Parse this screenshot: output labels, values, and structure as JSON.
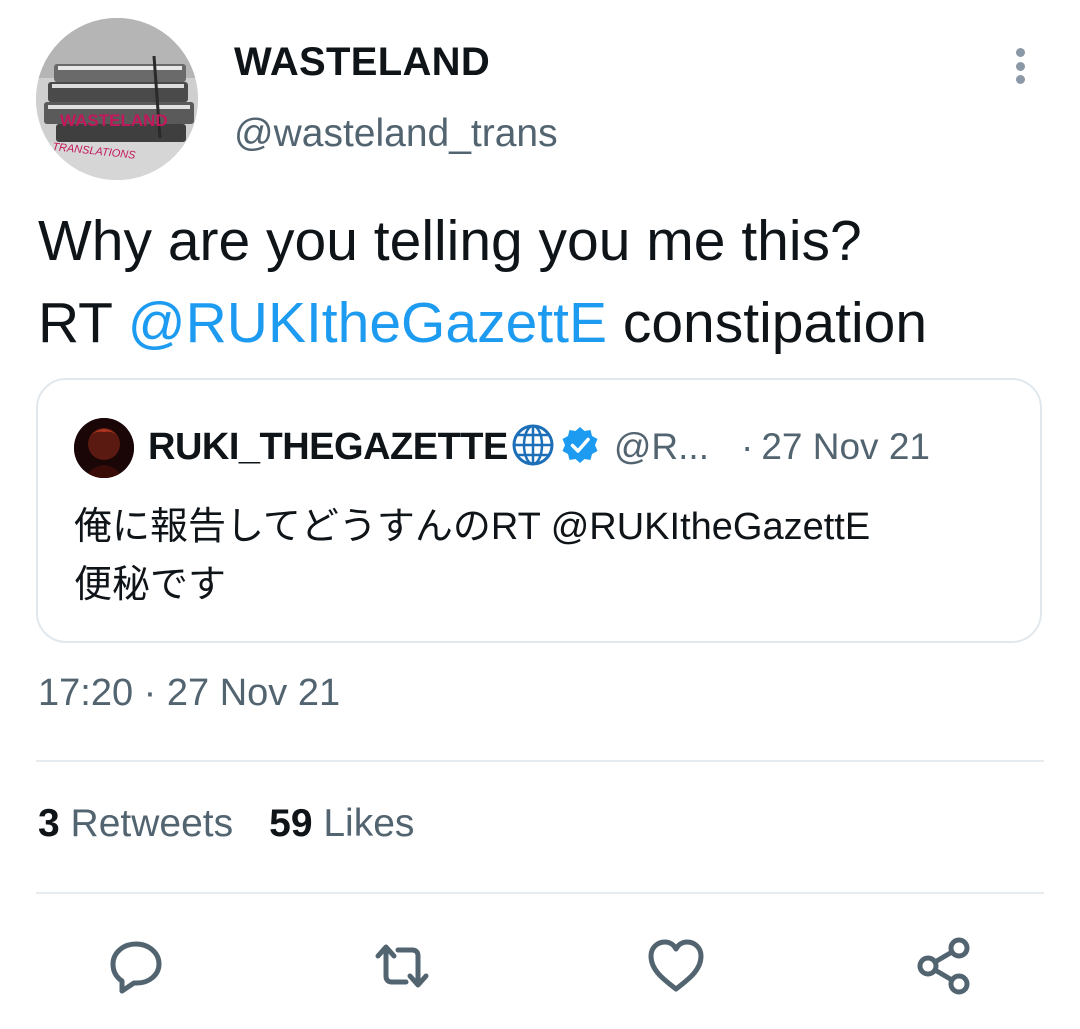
{
  "tweet": {
    "author": {
      "display_name": "WASTELAND",
      "handle": "@wasteland_trans",
      "avatar_text_line1": "WASTELAND",
      "avatar_text_line2": "TRANSLATIONS"
    },
    "text_part1": "Why are you telling you me this?",
    "text_rt": "RT",
    "text_mention": "@RUKItheGazettE",
    "text_part2": "constipation",
    "timestamp": "17:20 · 27 Nov 21"
  },
  "quote": {
    "name": "RUKI_THEGAZETTE",
    "handle": "@R...",
    "separator": "·",
    "date": "27 Nov 21",
    "text_line1": "俺に報告してどうすんのRT @RUKItheGazettE",
    "text_line2": "便秘です"
  },
  "stats": {
    "retweets_count": "3",
    "retweets_label": "Retweets",
    "likes_count": "59",
    "likes_label": "Likes"
  },
  "icons": {
    "more": "more-vertical-icon",
    "reply": "reply-icon",
    "retweet": "retweet-icon",
    "like": "heart-icon",
    "share": "share-icon",
    "globe": "globe-icon",
    "verified": "verified-badge-icon"
  },
  "colors": {
    "mention": "#1d9bf0",
    "secondary_text": "#536471",
    "verified": "#1d9bf0",
    "icon": "#536471",
    "avatar_text": "#c2185b"
  }
}
